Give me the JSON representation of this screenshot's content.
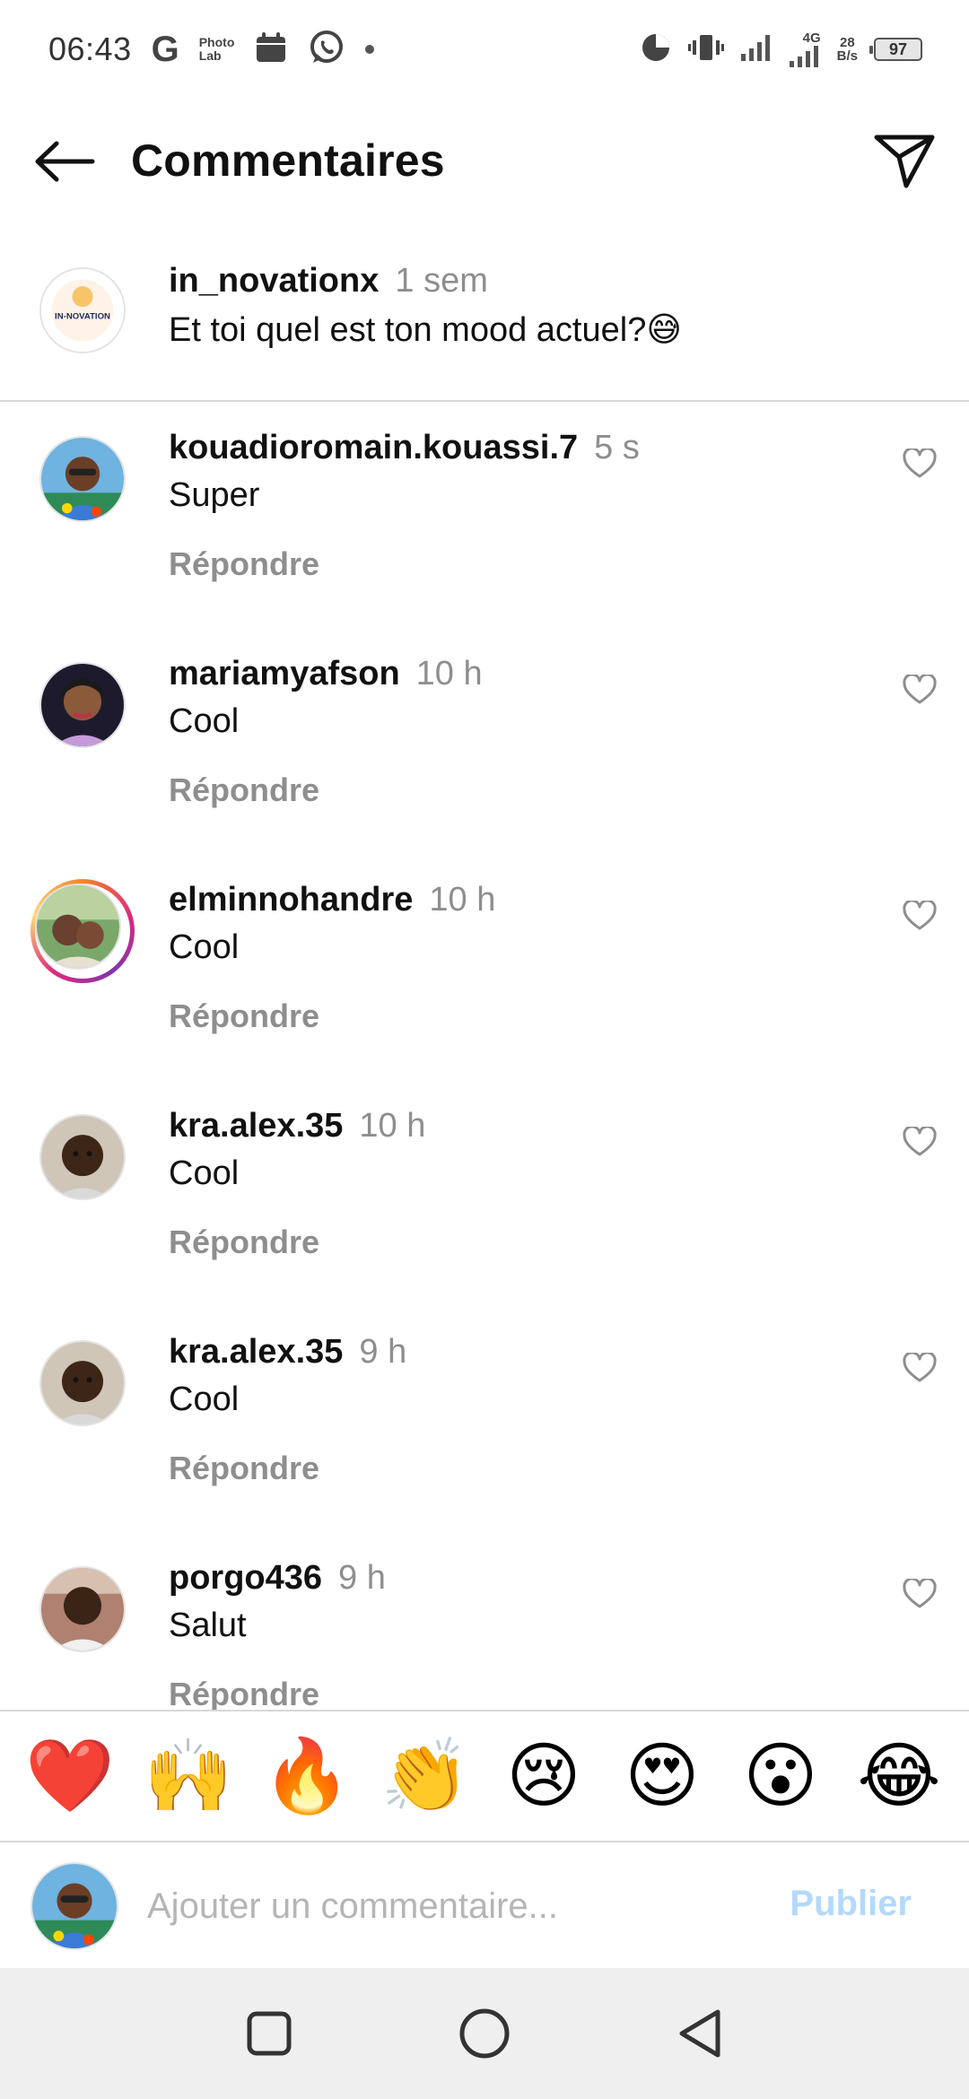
{
  "status_bar": {
    "time": "06:43",
    "app_icons": [
      "g-icon",
      "photo-lab-icon",
      "calendar-icon",
      "whatsapp-icon",
      "notification-dot"
    ],
    "g_label": "G",
    "photo_lab_label_1": "Photo",
    "photo_lab_label_2": "Lab",
    "network": "4G",
    "speed_value": "28",
    "speed_unit": "B/s",
    "battery": "97"
  },
  "header": {
    "title": "Commentaires"
  },
  "caption": {
    "username": "in_novationx",
    "time": "1 sem",
    "text": "Et toi quel est ton mood actuel?😅",
    "avatar_text": "IN-NOVATION"
  },
  "comments": [
    {
      "username": "kouadioromain.kouassi.7",
      "time": "5 s",
      "text": "Super",
      "reply": "Répondre"
    },
    {
      "username": "mariamyafson",
      "time": "10 h",
      "text": "Cool",
      "reply": "Répondre"
    },
    {
      "username": "elminnohandre",
      "time": "10 h",
      "text": "Cool",
      "reply": "Répondre"
    },
    {
      "username": "kra.alex.35",
      "time": "10 h",
      "text": "Cool",
      "reply": "Répondre"
    },
    {
      "username": "kra.alex.35",
      "time": "9 h",
      "text": "Cool",
      "reply": "Répondre"
    },
    {
      "username": "porgo436",
      "time": "9 h",
      "text": "Salut",
      "reply": "Répondre"
    }
  ],
  "emoji_bar": [
    "❤️",
    "🙌",
    "🔥",
    "👏",
    "😢",
    "😍",
    "😮",
    "😂"
  ],
  "input": {
    "placeholder": "Ajouter un commentaire...",
    "publish_label": "Publier"
  },
  "colors": {
    "muted": "#8e8e8e",
    "publish_disabled": "#b3d9fb",
    "divider": "#d8d8d8"
  }
}
